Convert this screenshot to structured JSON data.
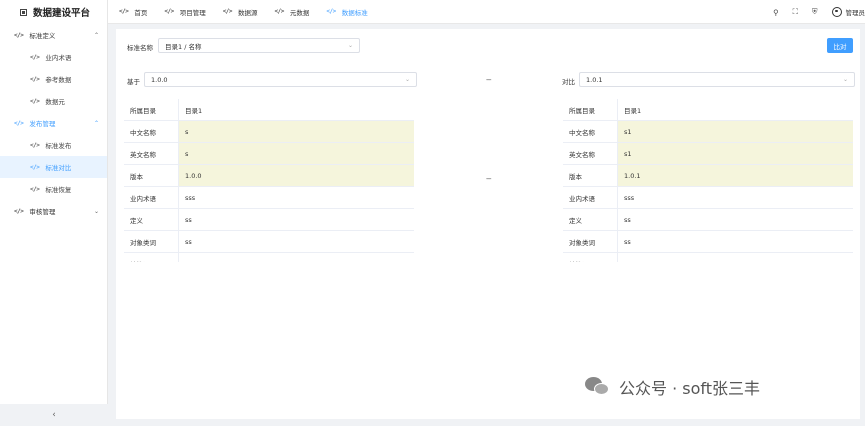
{
  "app": {
    "title": "数据建设平台"
  },
  "sidebar": {
    "groups": [
      {
        "label": "标准定义",
        "items": [
          "业内术语",
          "参考数据",
          "数据元"
        ]
      },
      {
        "label": "发布管理",
        "items": [
          "标准发布",
          "标准对比",
          "标准恢复"
        ]
      },
      {
        "label": "审核管理",
        "items": []
      }
    ],
    "collapse_glyph": "‹"
  },
  "topbar": {
    "tabs": [
      "首页",
      "项目管理",
      "数据源",
      "元数据",
      "数据标准"
    ],
    "user_name": "管理员"
  },
  "form": {
    "standard_label": "标准名称",
    "standard_value": "目录1 / 名称",
    "compare_button": "比对",
    "base_label": "基于",
    "base_version": "1.0.0",
    "target_label": "对比",
    "target_version": "1.0.1",
    "separator": "---"
  },
  "left_table": [
    {
      "k": "所属目录",
      "v": "目录1",
      "diff": false
    },
    {
      "k": "中文名称",
      "v": "s",
      "diff": true
    },
    {
      "k": "英文名称",
      "v": "s",
      "diff": true
    },
    {
      "k": "版本",
      "v": "1.0.0",
      "diff": true
    },
    {
      "k": "业内术语",
      "v": "sss",
      "diff": false
    },
    {
      "k": "定义",
      "v": "ss",
      "diff": false
    },
    {
      "k": "对象类词",
      "v": "ss",
      "diff": false
    },
    {
      "k": "特性词",
      "v": "ss",
      "diff": false
    }
  ],
  "right_table": [
    {
      "k": "所属目录",
      "v": "目录1",
      "diff": false
    },
    {
      "k": "中文名称",
      "v": "s1",
      "diff": true
    },
    {
      "k": "英文名称",
      "v": "s1",
      "diff": true
    },
    {
      "k": "版本",
      "v": "1.0.1",
      "diff": true
    },
    {
      "k": "业内术语",
      "v": "sss",
      "diff": false
    },
    {
      "k": "定义",
      "v": "ss",
      "diff": false
    },
    {
      "k": "对象类词",
      "v": "ss",
      "diff": false
    },
    {
      "k": "特性词",
      "v": "ss",
      "diff": false
    }
  ],
  "watermark": {
    "text": "公众号 · soft张三丰"
  },
  "colors": {
    "accent": "#409eff",
    "diff_bg": "#f5f5dc"
  }
}
